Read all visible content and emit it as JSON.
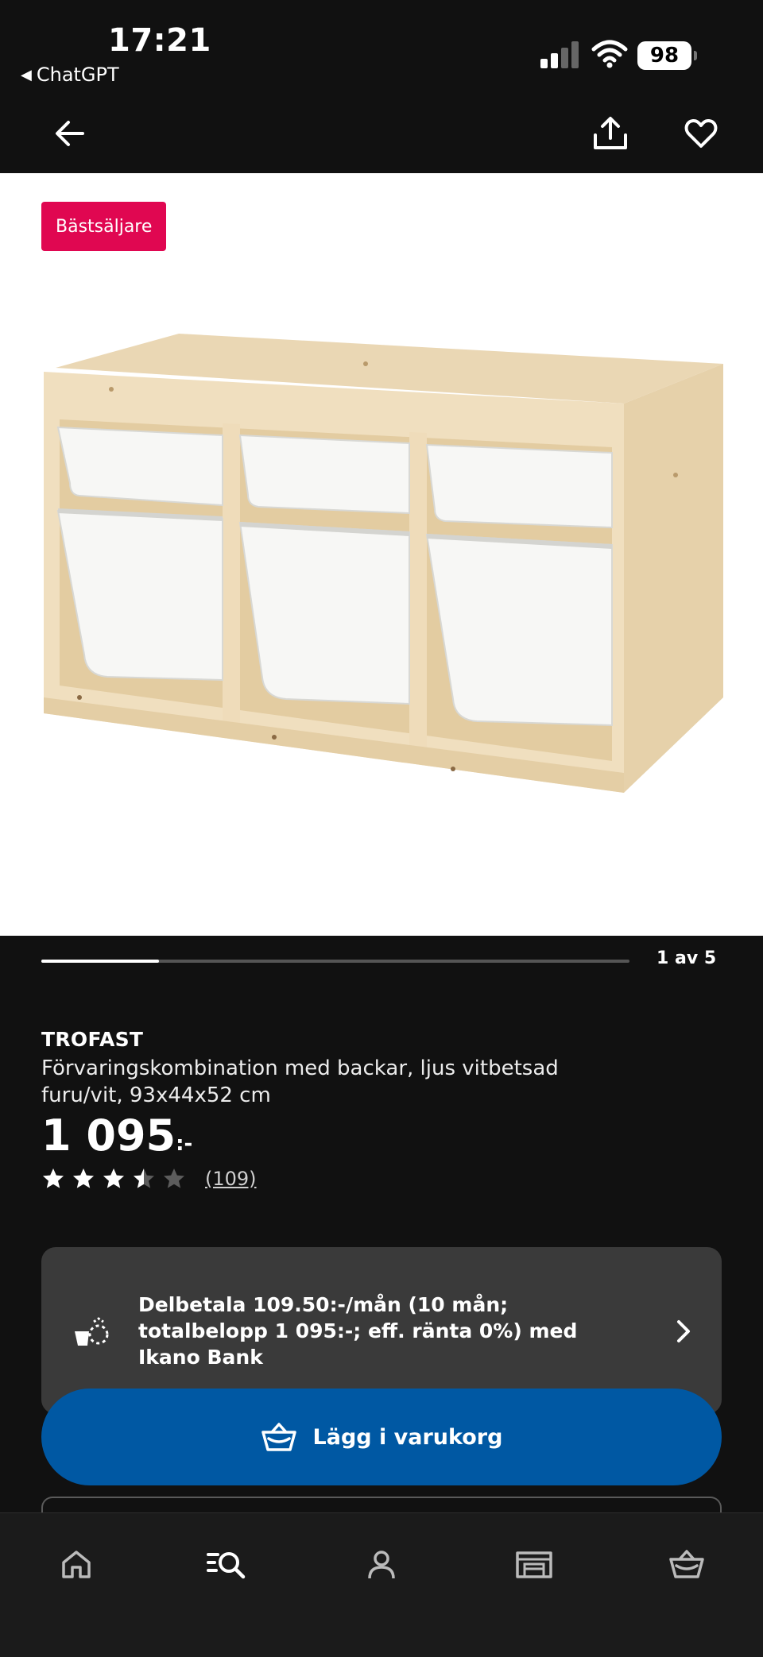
{
  "status_bar": {
    "time": "17:21",
    "back_app_label": "ChatGPT",
    "battery": "98"
  },
  "nav": {
    "back_icon": "arrow-left-icon",
    "share_icon": "share-icon",
    "favorite_icon": "heart-icon"
  },
  "gallery": {
    "badge": "Bästsäljare",
    "pager_label": "1 av 5",
    "current_index": 1,
    "total": 5
  },
  "product": {
    "name": "TROFAST",
    "description": "Förvaringskombination med backar, ljus vitbetsad furu/vit, 93x44x52 cm",
    "price_main": "1 095",
    "price_suffix": ":-",
    "rating_value": 3.5,
    "rating_max": 5,
    "review_count": "(109)"
  },
  "finance": {
    "text": "Delbetala 109.50:-/mån (10 mån; totalbelopp 1 095:-; eff. ränta 0%) med Ikano Bank",
    "icon": "payment-icon"
  },
  "cta": {
    "label": "Lägg i varukorg",
    "icon": "basket-icon"
  },
  "tabs": [
    {
      "icon": "home-icon"
    },
    {
      "icon": "search-icon"
    },
    {
      "icon": "profile-icon"
    },
    {
      "icon": "store-icon"
    },
    {
      "icon": "basket-icon"
    }
  ],
  "colors": {
    "background": "#111111",
    "badge": "#e00751",
    "cta": "#0058a3",
    "card": "#3a3a3a"
  }
}
